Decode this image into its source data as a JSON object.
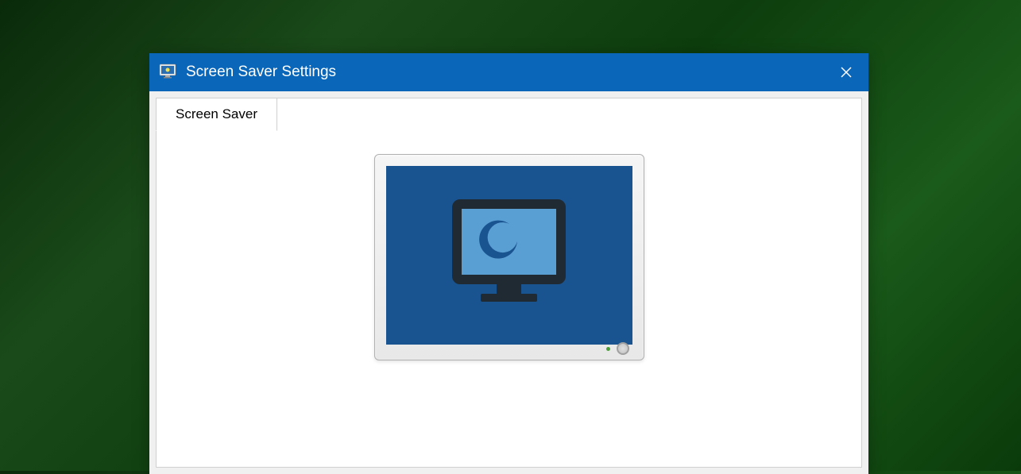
{
  "window": {
    "title": "Screen Saver Settings"
  },
  "tab": {
    "label": "Screen Saver"
  }
}
